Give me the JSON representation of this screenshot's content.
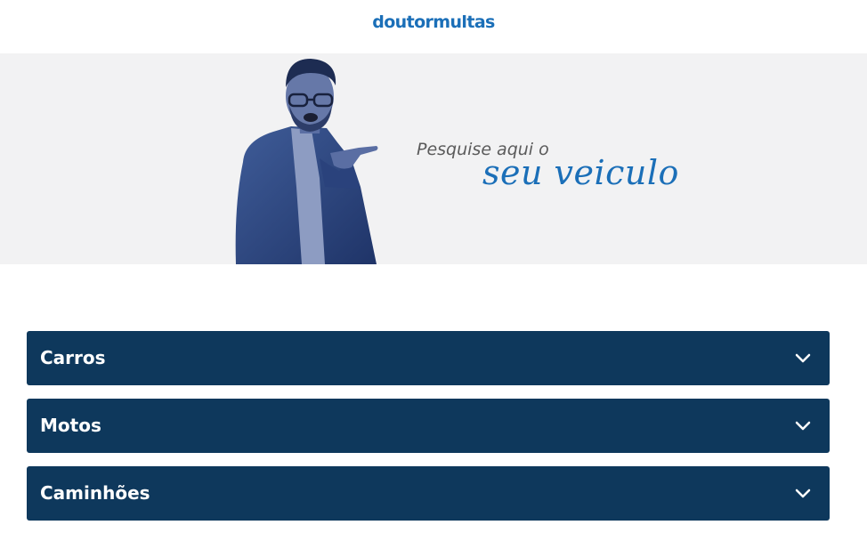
{
  "header": {
    "logo_text": "doutormultas"
  },
  "hero": {
    "tagline_line1": "Pesquise aqui o",
    "tagline_line2": "seu veiculo"
  },
  "categories": [
    {
      "label": "Carros",
      "icon": "chevron-down-icon"
    },
    {
      "label": "Motos",
      "icon": "chevron-down-icon"
    },
    {
      "label": "Caminhões",
      "icon": "chevron-down-icon"
    }
  ],
  "colors": {
    "brand_blue": "#1b6fb8",
    "accordion_bg": "#0e385c",
    "hero_bg": "#f2f2f3"
  }
}
